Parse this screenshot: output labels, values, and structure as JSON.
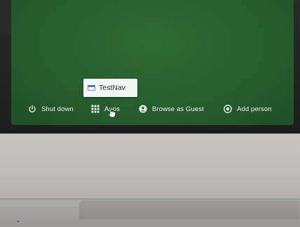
{
  "shelf": {
    "shutdown_label": "Shut down",
    "apps_label": "Apps",
    "guest_label": "Browse as Guest",
    "add_person_label": "Add person"
  },
  "apps_popup": {
    "items": [
      {
        "label": "TestNav",
        "icon": "testnav-app-icon"
      }
    ]
  },
  "colors": {
    "screen_background": "#275e2f",
    "shelf_text": "#f2f4f2",
    "popup_background": "#f4f5f5"
  }
}
